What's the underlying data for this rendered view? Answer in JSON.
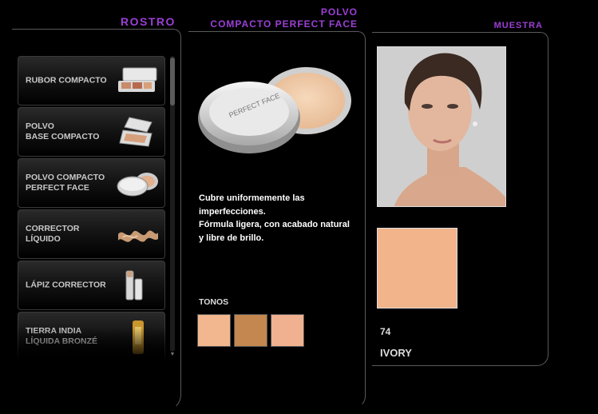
{
  "headings": {
    "rostro": "ROSTRO",
    "polvo_line1": "POLVO",
    "polvo_line2": "COMPACTO PERFECT FACE",
    "muestra": "MUESTRA"
  },
  "sidebar": {
    "items": [
      {
        "line1": "RUBOR COMPACTO",
        "line2": "",
        "icon": "blush-compact-icon"
      },
      {
        "line1": "POLVO",
        "line2": "BASE COMPACTO",
        "icon": "powder-compact-icon"
      },
      {
        "line1": "POLVO COMPACTO",
        "line2": "PERFECT FACE",
        "icon": "perfect-face-compact-icon"
      },
      {
        "line1": "CORRECTOR LÍQUIDO",
        "line2": "",
        "icon": "liquid-corrector-icon"
      },
      {
        "line1": "LÁPIZ CORRECTOR",
        "line2": "",
        "icon": "corrector-pencil-icon"
      },
      {
        "line1": "TIERRA INDIA",
        "line2": "LÍQUIDA BRONZÉ",
        "icon": "bronze-tube-icon"
      }
    ]
  },
  "product": {
    "description": [
      "Cubre uniformemente las",
      "imperfecciones.",
      "Fórmula ligera, con acabado natural",
      "y libre de brillo."
    ],
    "tones_label": "TONOS",
    "tones": [
      {
        "color": "#f2b78f"
      },
      {
        "color": "#c3874f"
      },
      {
        "color": "#f0b190"
      }
    ]
  },
  "sample": {
    "color": "#f1b48b",
    "code": "74",
    "name": "IVORY"
  },
  "colors": {
    "accent": "#9b3fd6",
    "background": "#000000"
  }
}
